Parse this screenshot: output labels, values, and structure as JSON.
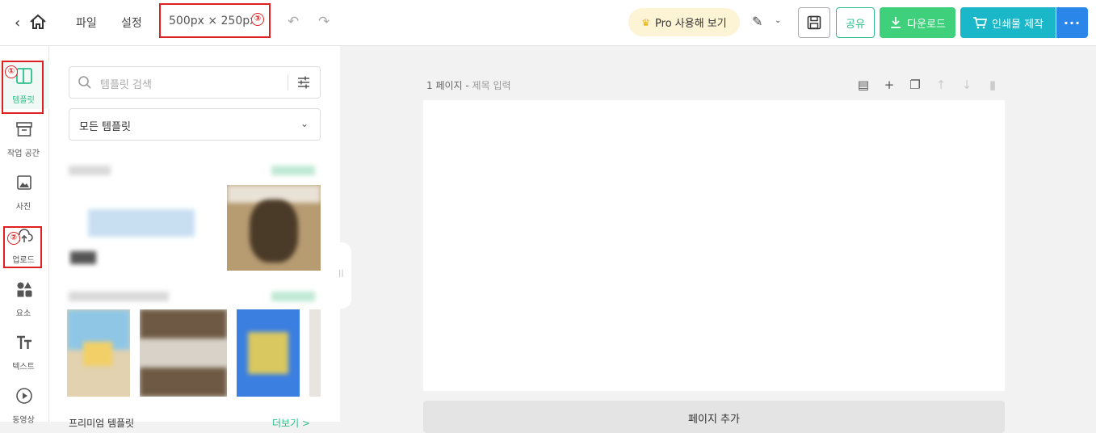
{
  "topbar": {
    "menu_file": "파일",
    "menu_settings": "설정",
    "canvas_size": "500px × 250px",
    "pro_label": "Pro 사용해 보기",
    "share_label": "공유",
    "download_label": "다운로드",
    "print_label": "인쇄물 제작",
    "more_label": "···"
  },
  "callouts": {
    "one": "①",
    "two": "②",
    "three": "③"
  },
  "sidebar": {
    "items": [
      {
        "label": "템플릿",
        "icon": "template-icon",
        "active": true
      },
      {
        "label": "작업 공간",
        "icon": "archive-icon"
      },
      {
        "label": "사진",
        "icon": "photo-icon"
      },
      {
        "label": "업로드",
        "icon": "cloud-upload-icon"
      },
      {
        "label": "요소",
        "icon": "shapes-icon"
      },
      {
        "label": "텍스트",
        "icon": "text-icon"
      },
      {
        "label": "동영상",
        "icon": "play-icon"
      }
    ]
  },
  "panel": {
    "search_placeholder": "템플릿 검색",
    "category_select": "모든 템플릿",
    "premium_section_title": "프리미엄 템플릿",
    "premium_more": "더보기 >"
  },
  "editor": {
    "page_number": "1 페이지 -",
    "page_title_placeholder": "제목 입력",
    "add_page": "페이지 추가"
  },
  "colors": {
    "accent_green": "#2cbf8a",
    "download_green": "#3fd07c",
    "print_teal": "#19b7c8",
    "more_blue": "#2a86e8",
    "callout_red": "#e02020"
  }
}
